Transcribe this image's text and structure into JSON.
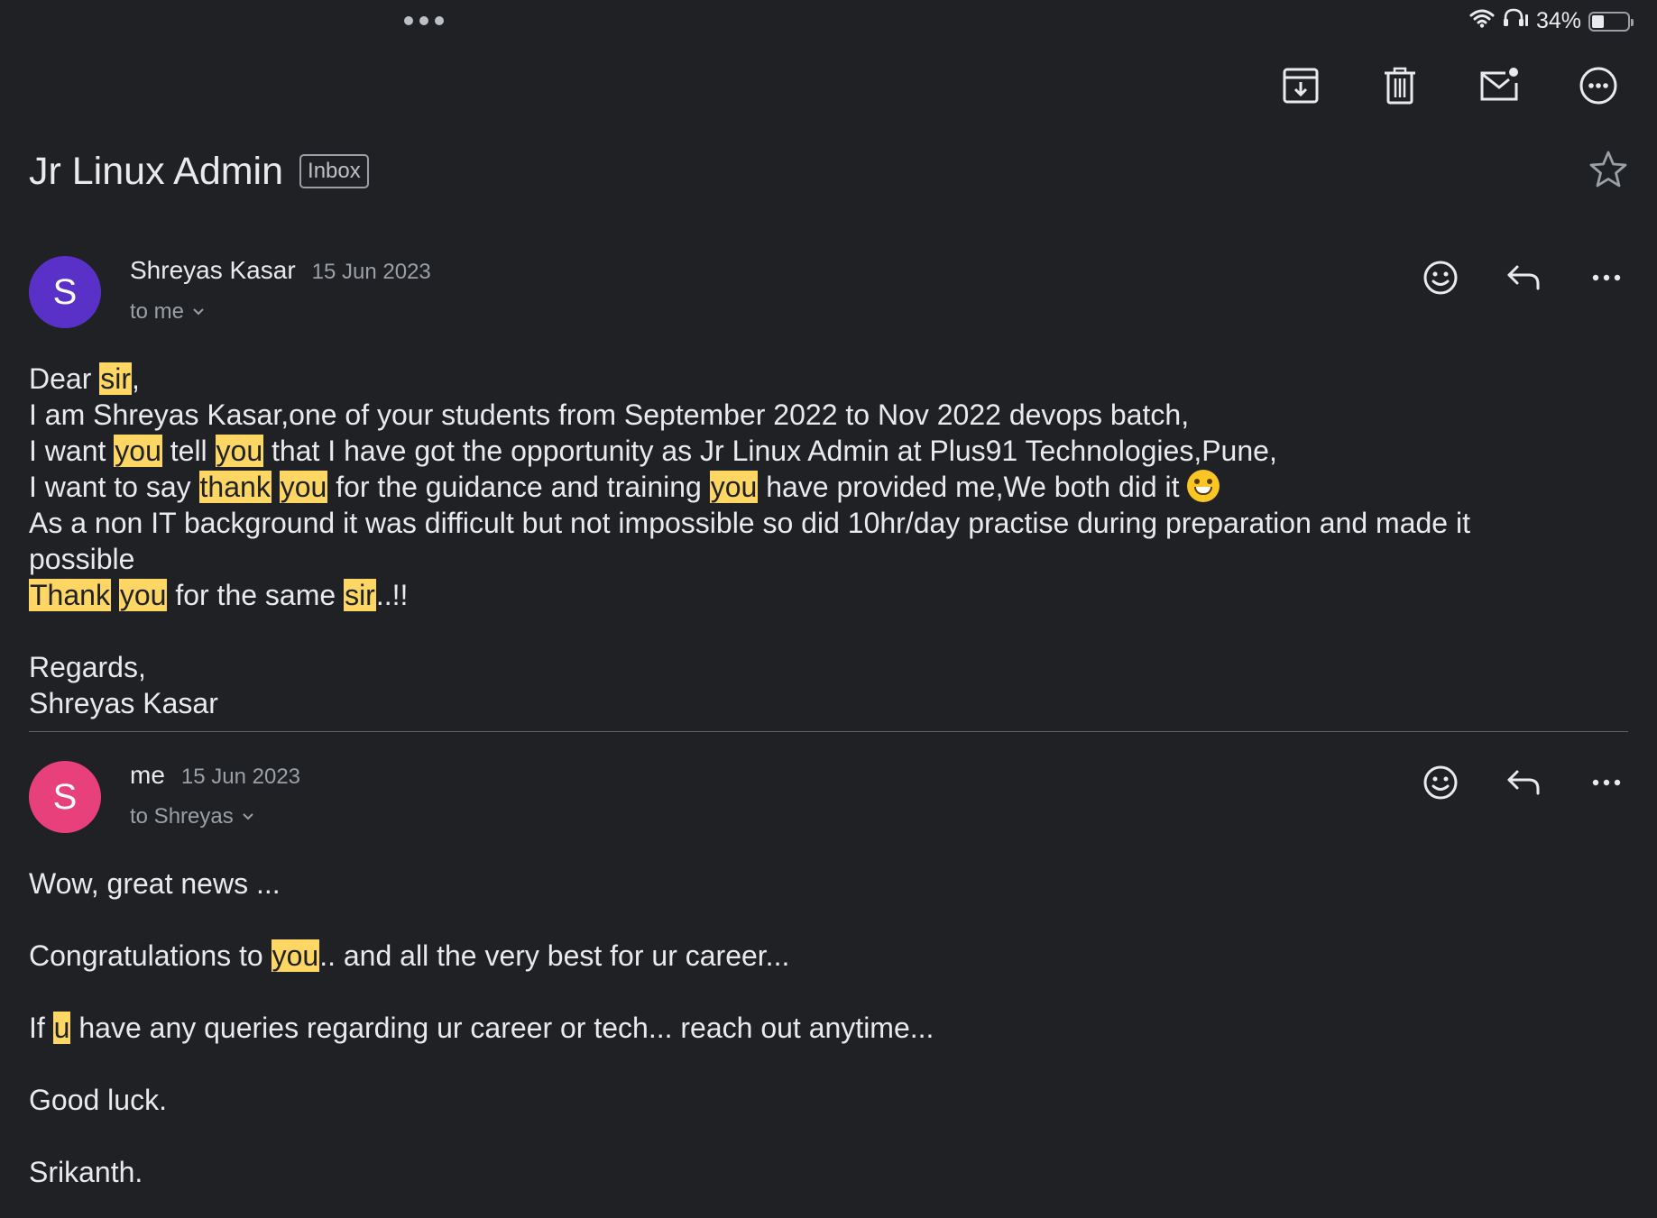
{
  "status_bar": {
    "battery": "34%",
    "battery_level": 0.34
  },
  "toolbar": {
    "icons": [
      "archive-icon",
      "trash-icon",
      "mark-unread-icon",
      "more-options-icon"
    ]
  },
  "subject": {
    "title": "Jr Linux Admin",
    "label": "Inbox"
  },
  "messages": [
    {
      "avatar_letter": "S",
      "avatar_color": "#5a31c8",
      "sender": "Shreyas Kasar",
      "date": "15 Jun 2023",
      "recipient": "to me",
      "body_lines": [
        [
          {
            "t": "Dear "
          },
          {
            "t": "sir",
            "h": true
          },
          {
            "t": ","
          }
        ],
        [
          {
            "t": "I am Shreyas Kasar,one of your students from September 2022 to Nov 2022 devops batch,"
          }
        ],
        [
          {
            "t": "I want "
          },
          {
            "t": "you",
            "h": true
          },
          {
            "t": " tell "
          },
          {
            "t": "you",
            "h": true
          },
          {
            "t": " that I have got the opportunity as Jr Linux Admin at Plus91 Technologies,Pune,"
          }
        ],
        [
          {
            "t": "I want to say "
          },
          {
            "t": "thank",
            "h": true
          },
          {
            "t": " "
          },
          {
            "t": "you",
            "h": true
          },
          {
            "t": " for the guidance and training "
          },
          {
            "t": "you",
            "h": true
          },
          {
            "t": " have provided me,We both did it "
          },
          {
            "emoji": "grinning-face"
          }
        ],
        [
          {
            "t": "As a non IT background it was difficult but not impossible so did 10hr/day practise during preparation and made it"
          }
        ],
        [
          {
            "t": "possible"
          }
        ],
        [
          {
            "t": "Thank",
            "h": true
          },
          {
            "t": " "
          },
          {
            "t": "you",
            "h": true
          },
          {
            "t": " for the same "
          },
          {
            "t": "sir",
            "h": true
          },
          {
            "t": "..!!"
          }
        ],
        [],
        [
          {
            "t": "Regards,"
          }
        ],
        [
          {
            "t": "Shreyas Kasar"
          }
        ]
      ]
    },
    {
      "avatar_letter": "S",
      "avatar_color": "#e8407a",
      "sender": "me",
      "date": "15 Jun 2023",
      "recipient": "to Shreyas",
      "body_lines": [
        [
          {
            "t": "Wow, great news ..."
          }
        ],
        [],
        [
          {
            "t": "Congratulations to "
          },
          {
            "t": "you",
            "h": true
          },
          {
            "t": ".. and all the very best for ur career..."
          }
        ],
        [],
        [
          {
            "t": "If "
          },
          {
            "t": "u",
            "h": true
          },
          {
            "t": " have any queries regarding ur career or tech... reach out anytime..."
          }
        ],
        [],
        [
          {
            "t": "Good luck."
          }
        ],
        [],
        [
          {
            "t": "Srikanth."
          }
        ]
      ]
    }
  ],
  "colors": {
    "background": "#202124",
    "highlight": "#fdd663",
    "text": "#e8eaed",
    "secondary_text": "#9aa0a6"
  }
}
